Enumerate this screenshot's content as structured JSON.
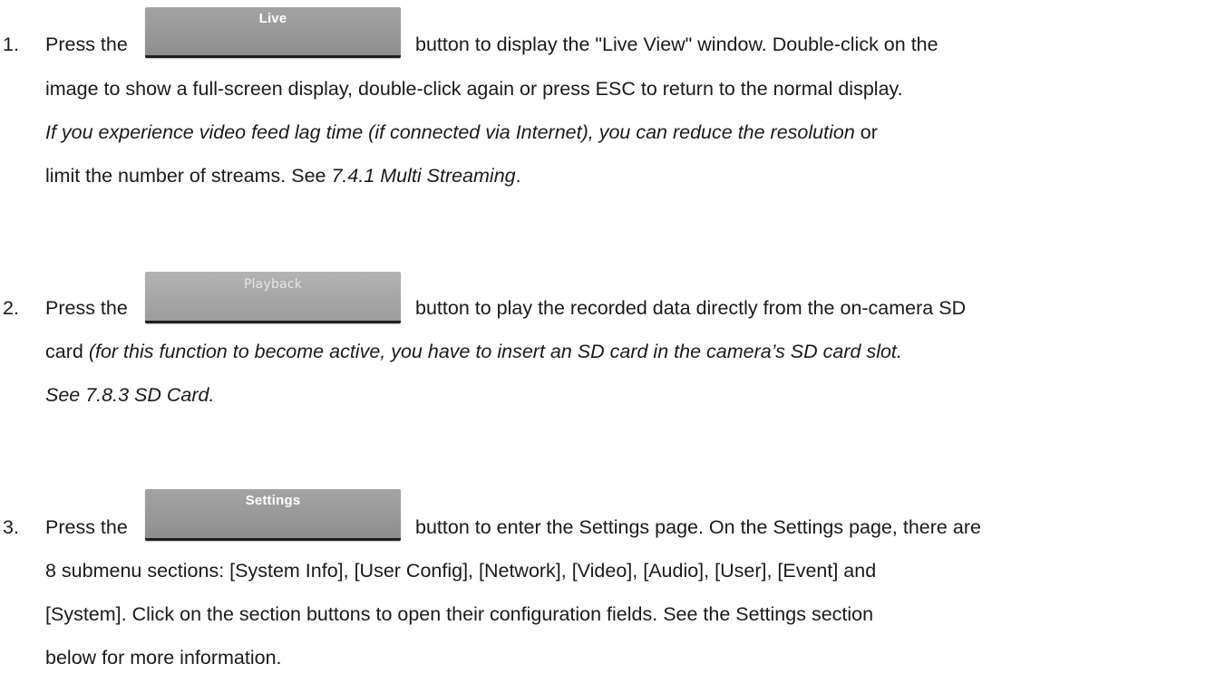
{
  "items": [
    {
      "number": "1.",
      "lead": "Press the",
      "button_label": "Live",
      "line1_rest": "button to display the \"Live View\" window. Double-click on the",
      "line2": "image to show a full-screen display, double-click again or press ESC to return to the normal display.",
      "line3_italic": "If you experience video feed lag time (if connected via Internet), you can reduce the resolution",
      "line3_tail": " or",
      "line4_pre": "limit the number of streams. See ",
      "line4_italic": "7.4.1 Multi Streaming",
      "line4_post": "."
    },
    {
      "number": "2.",
      "lead": "Press the",
      "button_label": "Playback",
      "line1_rest": "button to play the recorded data directly from the on-camera SD",
      "line2_pre": "card ",
      "line2_italic": "(for this function to become active, you have to insert an SD card in the camera’s SD card slot.",
      "line3_italic": "See 7.8.3 SD Card."
    },
    {
      "number": "3.",
      "lead": "Press the",
      "button_label": "Settings",
      "line1_rest": "button to enter the Settings page. On the Settings page, there are",
      "line2": "8 submenu sections: [System Info], [User Config], [Network], [Video], [Audio], [User], [Event] and",
      "line3": "[System]. Click on the section buttons to open their configuration fields. See the Settings section",
      "line4": "below for more information."
    }
  ]
}
